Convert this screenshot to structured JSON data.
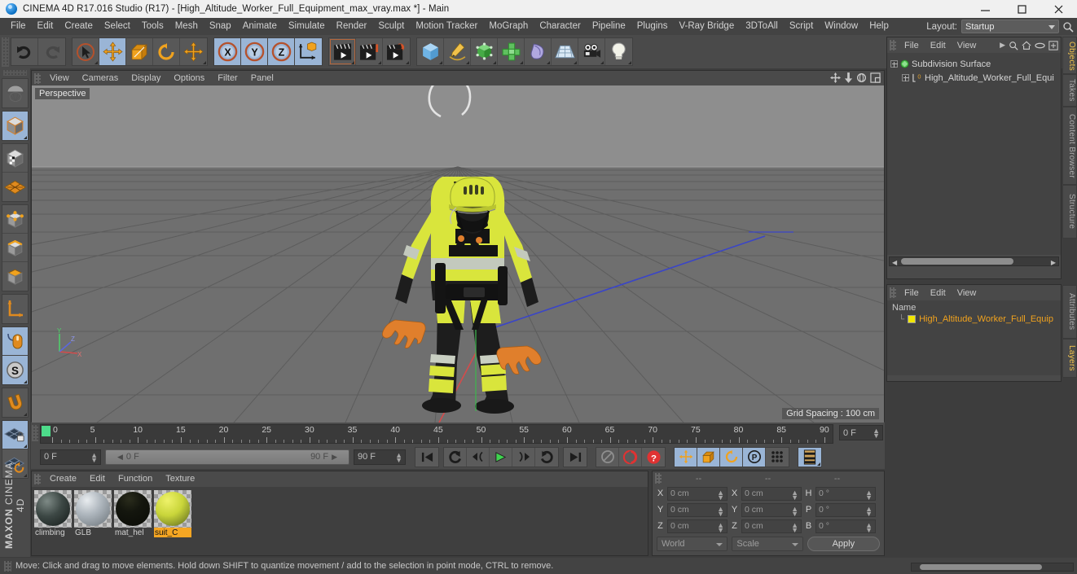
{
  "window": {
    "title": "CINEMA 4D R17.016 Studio (R17) - [High_Altitude_Worker_Full_Equipment_max_vray.max *] - Main",
    "minimize": "minimize-icon",
    "maximize": "maximize-icon",
    "close": "close-icon"
  },
  "menubar": {
    "items": [
      "File",
      "Edit",
      "Create",
      "Select",
      "Tools",
      "Mesh",
      "Snap",
      "Animate",
      "Simulate",
      "Render",
      "Sculpt",
      "Motion Tracker",
      "MoGraph",
      "Character",
      "Pipeline",
      "Plugins",
      "V-Ray Bridge",
      "3DToAll",
      "Script",
      "Window",
      "Help"
    ],
    "layout_label": "Layout:",
    "layout_value": "Startup"
  },
  "toolbar": {
    "groups": [
      {
        "buttons": [
          {
            "name": "undo-button",
            "icon": "undo",
            "selected": false,
            "corner": false
          },
          {
            "name": "redo-button",
            "icon": "redo",
            "selected": false,
            "corner": false
          }
        ]
      },
      {
        "buttons": [
          {
            "name": "live-selection-tool",
            "icon": "cursor",
            "selected": false,
            "corner": true
          },
          {
            "name": "move-tool",
            "icon": "move",
            "selected": true,
            "corner": false
          },
          {
            "name": "scale-tool",
            "icon": "scale",
            "selected": false,
            "corner": false
          },
          {
            "name": "rotate-tool",
            "icon": "rotate",
            "selected": false,
            "corner": false
          },
          {
            "name": "move-axis-tool",
            "icon": "move",
            "selected": false,
            "corner": true
          }
        ]
      },
      {
        "buttons": [
          {
            "name": "x-axis-lock-button",
            "icon": "x",
            "selected": true,
            "corner": false
          },
          {
            "name": "y-axis-lock-button",
            "icon": "y",
            "selected": true,
            "corner": false
          },
          {
            "name": "z-axis-lock-button",
            "icon": "z",
            "selected": true,
            "corner": false
          },
          {
            "name": "world-object-coord-button",
            "icon": "worldaxis",
            "selected": true,
            "corner": false
          }
        ]
      },
      {
        "buttons": [
          {
            "name": "render-view-button",
            "icon": "clapper",
            "selected": false,
            "corner": true
          },
          {
            "name": "render-to-picture-viewer-button",
            "icon": "clapper-pic",
            "selected": false,
            "corner": true
          },
          {
            "name": "render-settings-button",
            "icon": "clapper-gear",
            "selected": false,
            "corner": true
          }
        ]
      },
      {
        "buttons": [
          {
            "name": "cube-primitive-button",
            "icon": "cube",
            "selected": false,
            "corner": true
          },
          {
            "name": "spline-pen-button",
            "icon": "pen",
            "selected": false,
            "corner": true
          },
          {
            "name": "nurbs-generator-button",
            "icon": "green-cube",
            "selected": false,
            "corner": true
          },
          {
            "name": "array-modeling-button",
            "icon": "green-cluster",
            "selected": false,
            "corner": true
          },
          {
            "name": "deformer-button",
            "icon": "bend",
            "selected": false,
            "corner": true
          },
          {
            "name": "scene-floor-button",
            "icon": "floor",
            "selected": false,
            "corner": true
          },
          {
            "name": "camera-button",
            "icon": "camera",
            "selected": false,
            "corner": true
          },
          {
            "name": "light-button",
            "icon": "light",
            "selected": false,
            "corner": true
          }
        ]
      }
    ]
  },
  "left_toolbar": {
    "groups": [
      [
        {
          "name": "undo-view-tool",
          "icon": "parachute",
          "selected": false,
          "corner": false
        }
      ],
      [
        {
          "name": "model-mode-tool",
          "icon": "model-cube",
          "selected": true,
          "corner": true
        }
      ],
      [
        {
          "name": "texture-mode-tool",
          "icon": "texture-cube",
          "selected": false,
          "corner": false
        },
        {
          "name": "workplane-mode-tool",
          "icon": "mesh-plane",
          "selected": false,
          "corner": false
        }
      ],
      [
        {
          "name": "points-mode-tool",
          "icon": "points-cube",
          "selected": false,
          "corner": false
        },
        {
          "name": "edges-mode-tool",
          "icon": "edges-cube",
          "selected": false,
          "corner": false
        },
        {
          "name": "polygons-mode-tool",
          "icon": "polygons-cube",
          "selected": false,
          "corner": false
        }
      ],
      [
        {
          "name": "object-axis-tool",
          "icon": "axis",
          "selected": false,
          "corner": false
        }
      ],
      [
        {
          "name": "viewport-solo-tool",
          "icon": "mouse",
          "selected": true,
          "corner": false
        },
        {
          "name": "enable-axis-tool",
          "icon": "s-circle",
          "selected": true,
          "corner": true
        }
      ],
      [
        {
          "name": "snap-magnet-tool",
          "icon": "magnet",
          "selected": false,
          "corner": true
        }
      ],
      [
        {
          "name": "workplane-lock-tool",
          "icon": "plane-lock",
          "selected": true,
          "corner": true
        },
        {
          "name": "workplane-rotate-tool",
          "icon": "plane-rotate",
          "selected": false,
          "corner": true
        }
      ]
    ],
    "brand_top": "MAXON",
    "brand_bottom": "CINEMA 4D"
  },
  "viewport": {
    "menus": [
      "View",
      "Cameras",
      "Display",
      "Options",
      "Filter",
      "Panel"
    ],
    "label": "Perspective",
    "grid_spacing": "Grid Spacing : 100 cm",
    "nav_icons": [
      "pan-icon",
      "dolly-icon",
      "orbit-icon",
      "maximize-viewport-icon"
    ],
    "axis_labels": {
      "y": "Y",
      "z": "Z",
      "x": "X"
    }
  },
  "timeline": {
    "ticks": [
      0,
      5,
      10,
      15,
      20,
      25,
      30,
      35,
      40,
      45,
      50,
      55,
      60,
      65,
      70,
      75,
      80,
      85,
      90
    ],
    "current_frame_field": "0 F",
    "start_frame_field": "0 F",
    "range_start": "0 F",
    "range_end": "90 F",
    "end_frame_field": "90 F",
    "transport": [
      {
        "name": "go-to-start-button",
        "icon": "skip-back"
      },
      {
        "name": "play-backward-button",
        "icon": "loop-back"
      },
      {
        "name": "previous-key-button",
        "icon": "prev-key"
      },
      {
        "name": "play-button",
        "icon": "play"
      },
      {
        "name": "next-key-button",
        "icon": "next-key"
      },
      {
        "name": "play-forward-loop-button",
        "icon": "loop-fwd"
      },
      {
        "name": "go-to-end-button",
        "icon": "skip-fwd"
      }
    ],
    "record": [
      {
        "name": "record-active-objects-button",
        "icon": "record-disabled"
      },
      {
        "name": "autokeying-button",
        "icon": "autokey"
      },
      {
        "name": "keyframe-selection-button",
        "icon": "question"
      }
    ],
    "keyflags": [
      {
        "name": "position-key-button",
        "icon": "move",
        "selected": true
      },
      {
        "name": "scale-key-button",
        "icon": "scale",
        "selected": true
      },
      {
        "name": "rotation-key-button",
        "icon": "rotate",
        "selected": true
      },
      {
        "name": "parameter-key-button",
        "icon": "p-circle",
        "selected": true
      },
      {
        "name": "pla-key-button",
        "icon": "dots",
        "selected": false
      }
    ],
    "layers_button": {
      "name": "timeline-layers-button",
      "icon": "layers"
    }
  },
  "material_manager": {
    "menus": [
      "Create",
      "Edit",
      "Function",
      "Texture"
    ],
    "materials": [
      {
        "name": "climbing",
        "selected": false,
        "c1": "#5a5f5c",
        "c2": "#1e2424"
      },
      {
        "name": "GLB",
        "selected": false,
        "c1": "#b9bec3",
        "c2": "#7d848a"
      },
      {
        "name": "mat_hel",
        "selected": false,
        "c1": "#d9e23a",
        "c2": "#15170f"
      },
      {
        "name": "suit_C",
        "selected": true,
        "c1": "#d8e04a",
        "c2": "#3a3e1c"
      }
    ]
  },
  "coordinates": {
    "headers": [
      "--",
      "--",
      "--"
    ],
    "rows": [
      {
        "l1": "X",
        "v1": "0 cm",
        "l2": "X",
        "v2": "0 cm",
        "l3": "H",
        "v3": "0 °"
      },
      {
        "l1": "Y",
        "v1": "0 cm",
        "l2": "Y",
        "v2": "0 cm",
        "l3": "P",
        "v3": "0 °"
      },
      {
        "l1": "Z",
        "v1": "0 cm",
        "l2": "Z",
        "v2": "0 cm",
        "l3": "B",
        "v3": "0 °"
      }
    ],
    "system": "World",
    "mode": "Scale",
    "apply": "Apply"
  },
  "object_manager": {
    "menus": [
      "File",
      "Edit",
      "View"
    ],
    "icons": [
      "more-arrow-icon",
      "search-icon",
      "home-icon",
      "link-icon",
      "add-layer-icon"
    ],
    "rows": [
      {
        "name": "Subdivision Surface",
        "depth": 0,
        "icon": "subdivision-icon"
      },
      {
        "name": "High_Altitude_Worker_Full_Equi",
        "depth": 1,
        "icon": "null-object-icon"
      }
    ]
  },
  "attribute_manager": {
    "menus": [
      "File",
      "Edit",
      "View"
    ],
    "column": "Name",
    "rows": [
      {
        "name": "High_Altitude_Worker_Full_Equip",
        "color": "#f2e600"
      }
    ]
  },
  "right_tabs": [
    {
      "label": "Objects",
      "active": true
    },
    {
      "label": "Takes",
      "active": false
    },
    {
      "label": "Content Browser",
      "active": false
    },
    {
      "label": "Structure",
      "active": false
    },
    {
      "label": "Attributes",
      "active": false
    },
    {
      "label": "Layers",
      "active": true
    }
  ],
  "statusbar": {
    "text": "Move: Click and drag to move elements. Hold down SHIFT to quantize movement / add to the selection in point mode, CTRL to remove."
  },
  "colors": {
    "accent_orange": "#f5a623",
    "select_blue": "#9ab5d6",
    "panel": "#4a4a4a",
    "viewport_sky": "#8a8a8a",
    "viewport_ground": "#6d6d6d"
  }
}
